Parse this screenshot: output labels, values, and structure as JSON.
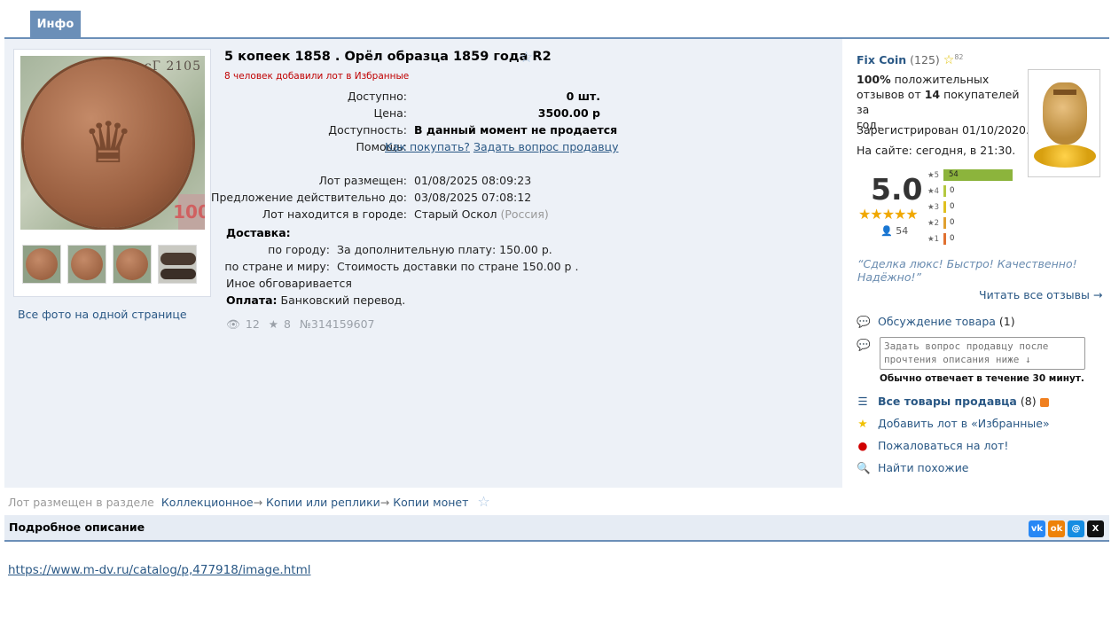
{
  "tab": {
    "label": "Инфо"
  },
  "lot": {
    "title": "5 копеек 1858 . Орёл образца 1859 года R2",
    "fav_count_text": "8 человек добавили лот в Избранные",
    "available_label": "Доступно:",
    "available_value": "0 шт.",
    "price_label": "Цена:",
    "price_value": "3500.00 р",
    "availability_label": "Доступность:",
    "availability_value": "В данный момент не продается",
    "help_label": "Помощь:",
    "help_link1": "Как покупать?",
    "help_link2": "Задать вопрос продавцу",
    "placed_label": "Лот размещен:",
    "placed_value": "01/08/2025 08:09:23",
    "valid_label": "Предложение действительно до:",
    "valid_value": "03/08/2025 07:08:12",
    "city_label": "Лот находится в городе:",
    "city_value": "Старый Оскол",
    "country_value": "(Россия)",
    "delivery_label": "Доставка:",
    "city_delivery_label": "по городу:",
    "city_delivery_value": "За дополнительную плату: 150.00 р.",
    "world_delivery_label": "по стране и миру:",
    "world_delivery_value": "Стоимость доставки по стране 150.00 р .",
    "other_text": "Иное обговаривается",
    "payment_label": "Оплата:",
    "payment_value": "Банковский перевод.",
    "views": "12",
    "stars": "8",
    "lot_number": "№314159607"
  },
  "photos": {
    "serial_text": "сГ 2105",
    "bill_number": "100",
    "all_photos_link": "Все фото на одной странице"
  },
  "seller": {
    "name": "Fix Coin",
    "count": "(125)",
    "sup": "82",
    "percent": "100%",
    "feedback_text1": "положительных",
    "feedback_text2": "отзывов от",
    "buyers": "14",
    "feedback_text3": "покупателей за",
    "feedback_text4": "год.",
    "registered": "Зарегистрирован 01/10/2020.",
    "online": "На сайте: сегодня, в 21:30.",
    "score": "5.0",
    "score_stars": "★★★★★",
    "reviews_count": "54",
    "bars": [
      {
        "label": "5",
        "count": "54",
        "fraction": 1.0,
        "color": "#8cb43c"
      },
      {
        "label": "4",
        "count": "0",
        "fraction": 0,
        "color": "#b4c840"
      },
      {
        "label": "3",
        "count": "0",
        "fraction": 0,
        "color": "#e0c020"
      },
      {
        "label": "2",
        "count": "0",
        "fraction": 0,
        "color": "#e0a030"
      },
      {
        "label": "1",
        "count": "0",
        "fraction": 0,
        "color": "#e07030"
      }
    ],
    "quote": "“Сделка люкс! Быстро! Качественно! Надёжно!”",
    "read_all": "Читать все отзывы →"
  },
  "actions": {
    "discussion": "Обсуждение товара",
    "discussion_count": "(1)",
    "ask_placeholder": "Задать вопрос продавцу после прочтения описания ниже ↓",
    "reply_time": "Обычно отвечает в течение 30 минут.",
    "all_goods": "Все товары продавца",
    "all_goods_count": "(8)",
    "add_fav": "Добавить лот в «Избранные»",
    "complain": "Пожаловаться на лот!",
    "find_similar": "Найти похожие"
  },
  "breadcrumb": {
    "prefix": "Лот размещен в разделе",
    "items": [
      "Коллекционное",
      "Копии или реплики",
      "Копии монет"
    ],
    "arrow": "→"
  },
  "description": {
    "title": "Подробное описание",
    "link": "https://www.m-dv.ru/catalog/p,477918/image.html"
  },
  "share": {
    "vk": "vk",
    "ok": "ok",
    "mm": "@",
    "x": "X",
    "colors": {
      "vk": "#2787f5",
      "ok": "#ee8208",
      "mm": "#168de2",
      "x": "#111111"
    }
  },
  "colors": {
    "accent": "#6b8fb8",
    "link": "#2a5885",
    "panel_bg": "#edf1f7",
    "warn": "#c00000"
  }
}
